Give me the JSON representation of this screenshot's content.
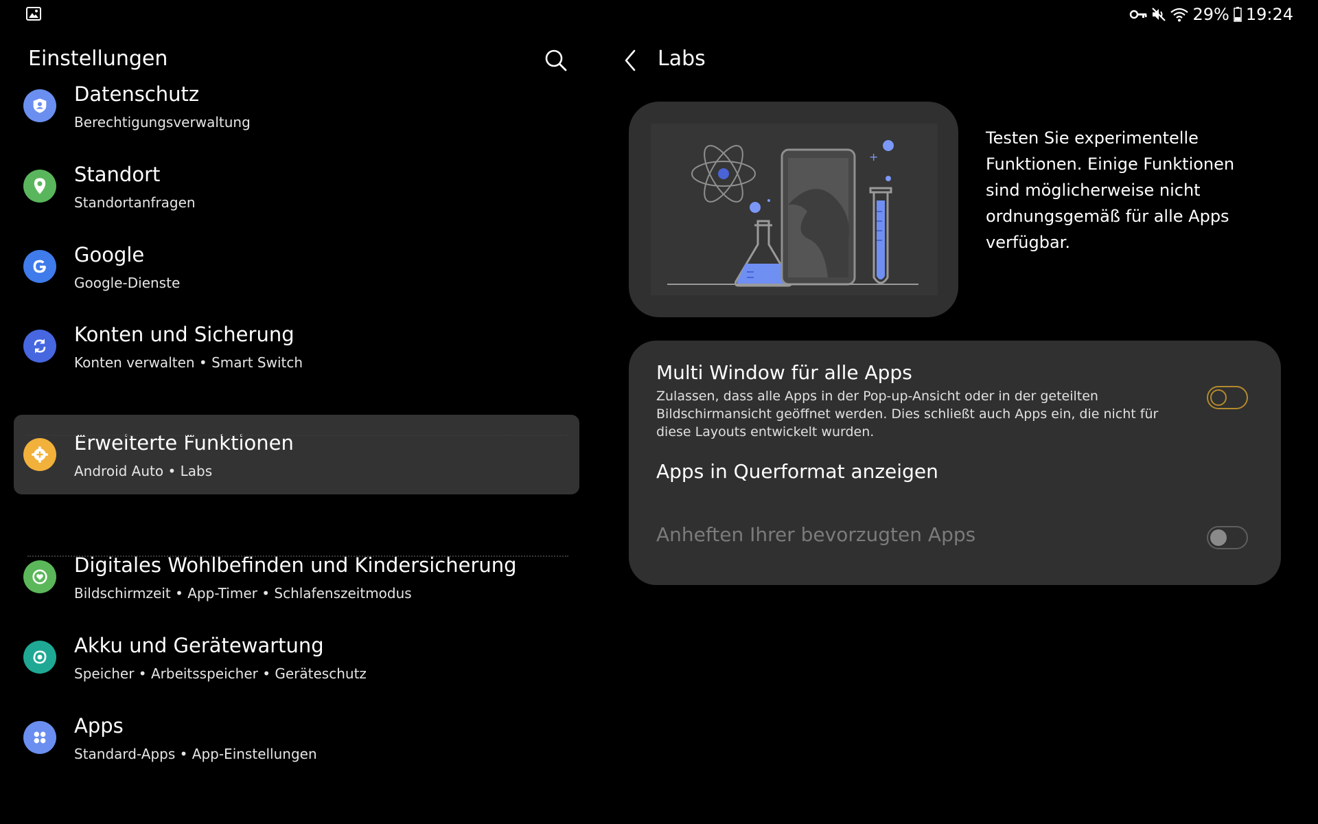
{
  "status_bar": {
    "battery": "29%",
    "time": "19:24"
  },
  "left_pane": {
    "title": "Einstellungen",
    "items": [
      {
        "title": "Datenschutz",
        "subtitle": "Berechtigungsverwaltung",
        "icon": "shield-person-icon",
        "color": "#6a8ff0"
      },
      {
        "title": "Standort",
        "subtitle": "Standortanfragen",
        "icon": "location-pin-icon",
        "color": "#5ab65c"
      },
      {
        "title": "Google",
        "subtitle": "Google-Dienste",
        "icon": "google-g-icon",
        "color": "#3f7bea"
      },
      {
        "title": "Konten und Sicherung",
        "subtitle": "Konten verwalten  •  Smart Switch",
        "icon": "sync-icon",
        "color": "#4667e0"
      },
      {
        "title": "Erweiterte Funktionen",
        "subtitle": "Android Auto  •  Labs",
        "icon": "gear-plus-icon",
        "color": "#f2b13a",
        "selected": true
      },
      {
        "title": "Digitales Wohlbefinden und Kindersicherung",
        "subtitle": "Bildschirmzeit  •  App-Timer  •  Schlafenszeitmodus",
        "icon": "heart-circle-icon",
        "color": "#5bb75a"
      },
      {
        "title": "Akku und Gerätewartung",
        "subtitle": "Speicher  •  Arbeitsspeicher  •  Geräteschutz",
        "icon": "device-care-icon",
        "color": "#1fa994"
      },
      {
        "title": "Apps",
        "subtitle": "Standard-Apps  •  App-Einstellungen",
        "icon": "apps-grid-icon",
        "color": "#6a8ff0"
      }
    ]
  },
  "right_pane": {
    "title": "Labs",
    "intro": "Testen Sie experimentelle Funktionen. Einige Funktionen sind möglicherweise nicht ordnungsgemäß für alle Apps verfügbar.",
    "settings": [
      {
        "title": "Multi Window für alle Apps",
        "description": "Zulassen, dass alle Apps in der Pop-up-Ansicht oder in der geteilten Bildschirmansicht geöffnet werden. Dies schließt auch Apps ein, die nicht für diese Layouts entwickelt wurden.",
        "toggle": "off",
        "enabled": true
      },
      {
        "title": "Apps in Querformat anzeigen",
        "enabled": true
      },
      {
        "title": "Anheften Ihrer bevorzugten Apps",
        "toggle": "off",
        "enabled": false
      }
    ]
  },
  "colors": {
    "background": "#000000",
    "card": "#303030",
    "selected_item": "#333333",
    "accent_toggle": "#b38a2e",
    "illustration_blue": "#6f8ff2"
  }
}
